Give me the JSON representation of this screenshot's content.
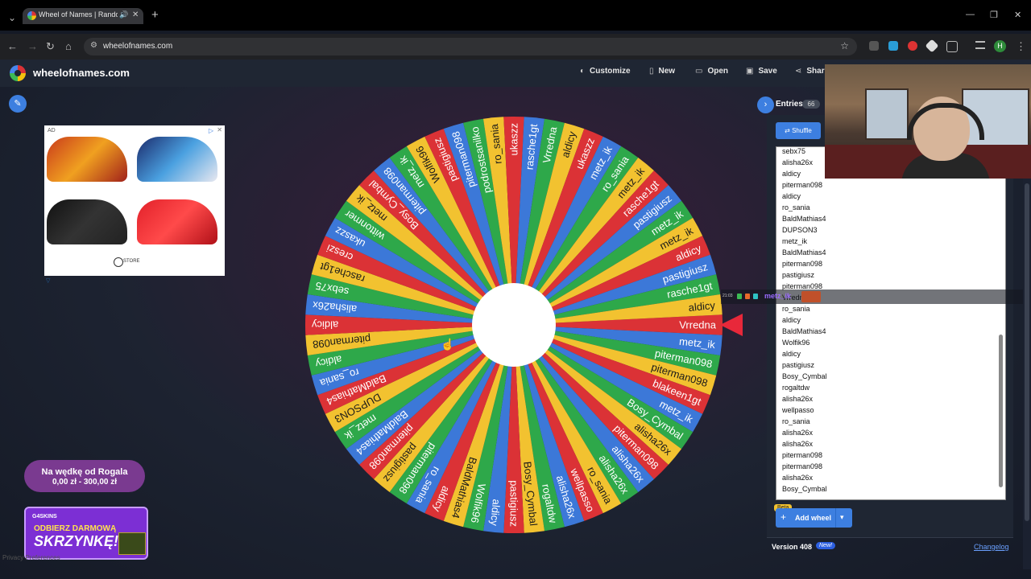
{
  "browser": {
    "tab_title": "Wheel of Names | Random",
    "url": "wheelofnames.com",
    "profile_initial": "H"
  },
  "header": {
    "site_name": "wheelofnames.com",
    "menu": [
      "Customize",
      "New",
      "Open",
      "Save",
      "Share"
    ]
  },
  "ad": {
    "label": "AD",
    "brand": "STORE"
  },
  "promos": {
    "p1_line1": "Na wędkę od Rogala",
    "p1_line2": "0,00 zł - 300,00 zł",
    "p2_brand": "G4SKINS",
    "p2_line1": "ODBIERZ DARMOWĄ",
    "p2_line2": "SKRZYNKĘ!",
    "privacy": "Privacy Preferences"
  },
  "wheel": {
    "colors": [
      "#db3236",
      "#3c78d8",
      "#2ea84a",
      "#f2c230"
    ],
    "text_colors": [
      "#ffffff",
      "#ffffff",
      "#ffffff",
      "#1a1a1a"
    ],
    "slices": [
      "Vrredna",
      "metz_ik",
      "piterman098",
      "piterman098",
      "blakeen1gt",
      "metz_ik",
      "Bosy_Cymbal",
      "alisha26x",
      "piterman098",
      "alisha26x",
      "alisha26x",
      "ro_sania",
      "wellpasso",
      "alisha26x",
      "rogaltdw",
      "Bosy_Cymbal",
      "pastigiusz",
      "aldicy",
      "Wolfik96",
      "BaldMathias4",
      "aldicy",
      "ro_sania",
      "piterman098",
      "pastigiusz",
      "piterman098",
      "BaldMathias4",
      "metz_ik",
      "DUPSON3",
      "BaldMathias4",
      "ro_sania",
      "aldicy",
      "piterman098",
      "aldicy",
      "alisha26x",
      "sebx75",
      "rasche1gt",
      "creszi",
      "ukaszz",
      "wittonmer",
      "metz_ik",
      "Bosy_Cymbal",
      "piterman098",
      "metz_ik",
      "Wolfik96",
      "pastigiusz",
      "piterman098",
      "podrostsanilko",
      "ro_sania",
      "ukaszz",
      "rasche1gt",
      "Vrredna",
      "aldicy",
      "ukaszz",
      "metz_ik",
      "ro_sania",
      "metz_ik",
      "rasche1gt",
      "pastigiusz",
      "metz_ik",
      "metz_ik",
      "aldicy",
      "pastigiusz",
      "rasche1gt",
      "aldicy"
    ]
  },
  "panel": {
    "entries_label": "Entries",
    "entries_count": "66",
    "shuffle_label": "Shuffle",
    "entries": [
      "sebx75",
      "alisha26x",
      "aldicy",
      "piterman098",
      "aldicy",
      "ro_sania",
      "BaldMathias4",
      "DUPSON3",
      "metz_ik",
      "BaldMathias4",
      "piterman098",
      "pastigiusz",
      "piterman098",
      "Vrredna",
      "ro_sania",
      "aldicy",
      "BaldMathias4",
      "Wolfik96",
      "aldicy",
      "pastigiusz",
      "Bosy_Cymbal",
      "rogaltdw",
      "alisha26x",
      "wellpasso",
      "ro_sania",
      "alisha26x",
      "alisha26x",
      "piterman098",
      "piterman098",
      "alisha26x",
      "Bosy_Cymbal"
    ],
    "beta_label": "Beta",
    "add_wheel_label": "Add wheel",
    "version_label": "Version 408",
    "new_badge": "New!",
    "changelog_label": "Changelog"
  },
  "chat": {
    "time": "21:03",
    "username": "metz_ik"
  }
}
